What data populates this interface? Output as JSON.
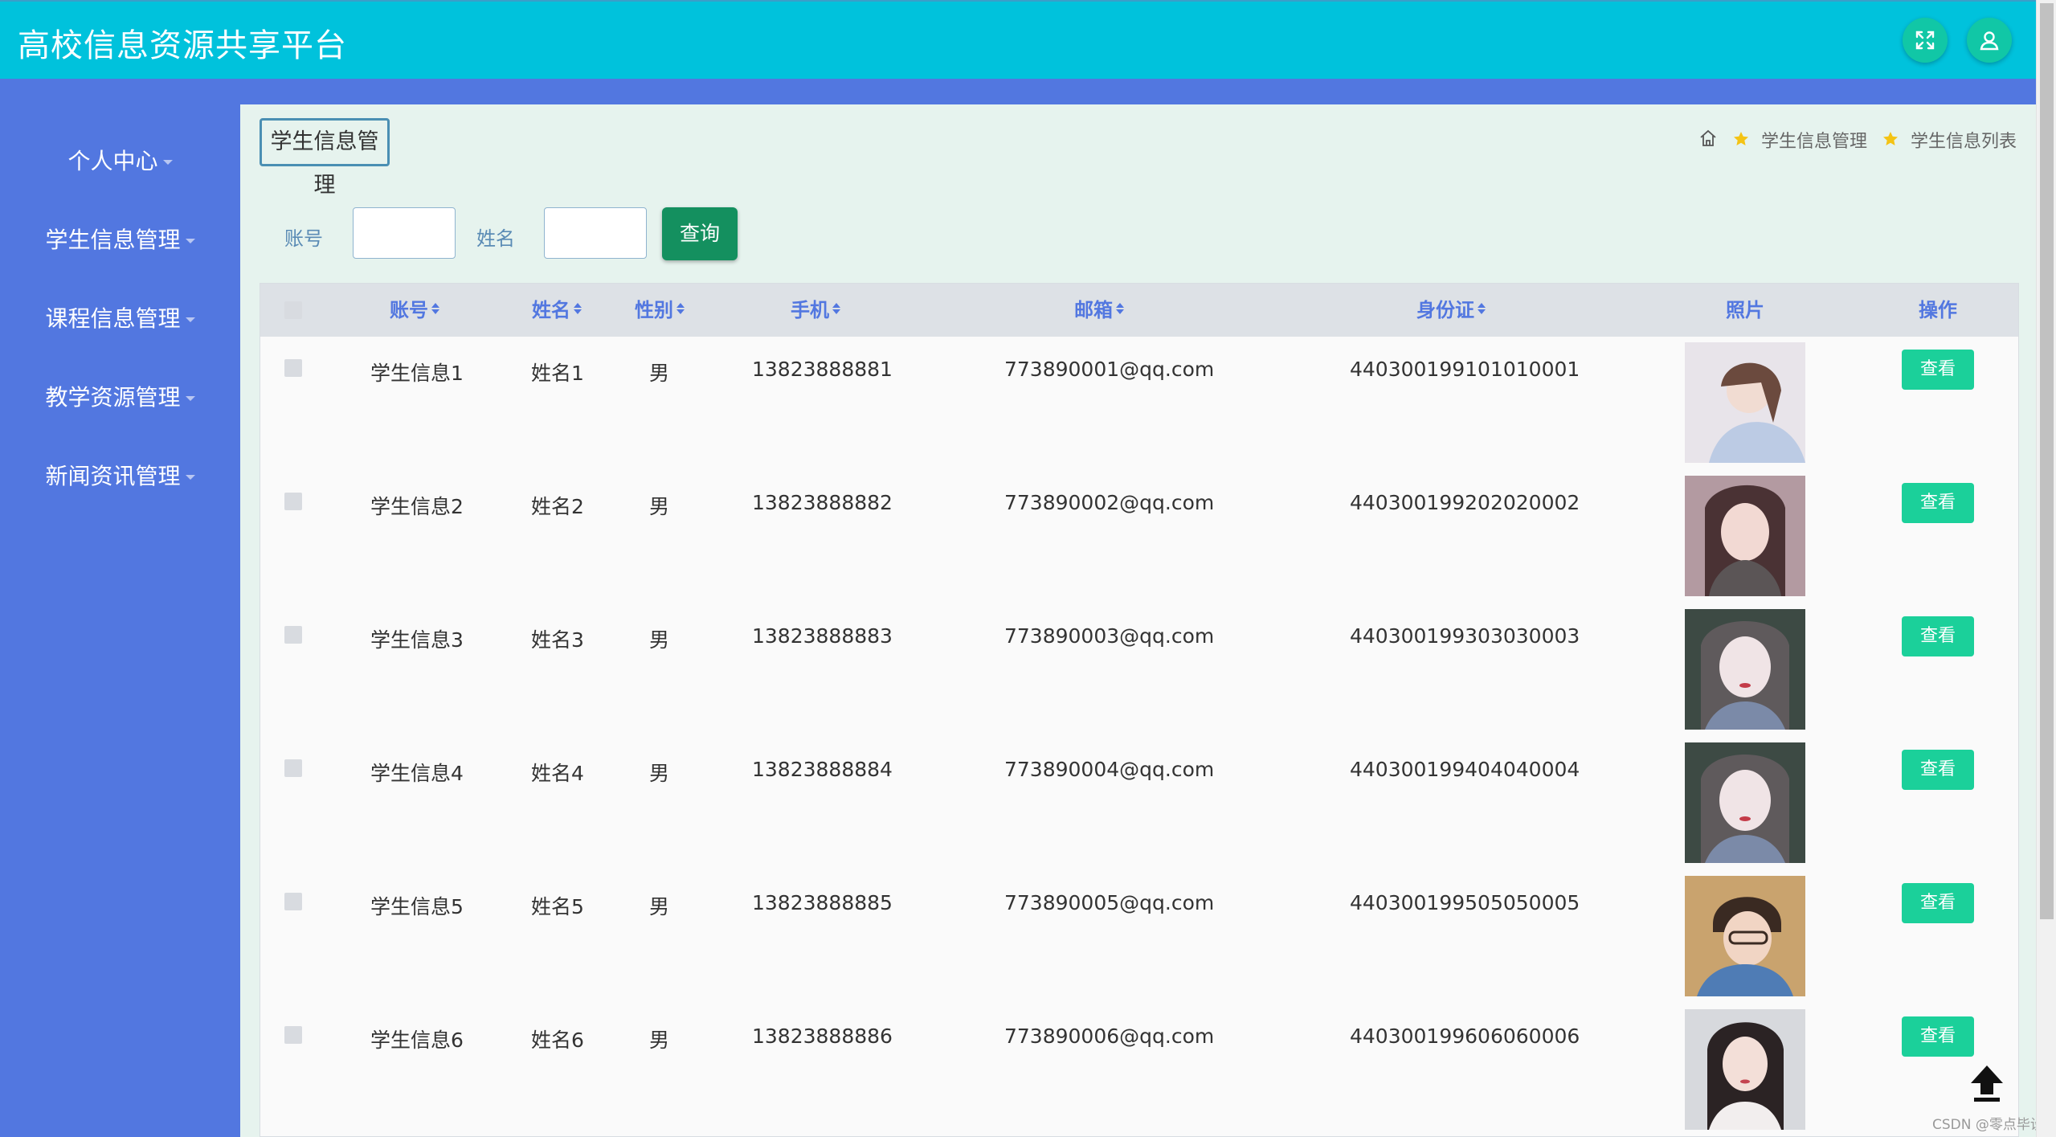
{
  "app": {
    "title": "高校信息资源共享平台"
  },
  "header": {
    "fullscreen_icon": "fullscreen-icon",
    "user_icon": "user-icon"
  },
  "sidebar": {
    "items": [
      {
        "label": "个人中心"
      },
      {
        "label": "学生信息管理"
      },
      {
        "label": "课程信息管理"
      },
      {
        "label": "教学资源管理"
      },
      {
        "label": "新闻资讯管理"
      }
    ]
  },
  "page": {
    "tag": "学生信息管理",
    "breadcrumb": [
      "学生信息管理",
      "学生信息列表"
    ]
  },
  "search": {
    "account_label": "账号",
    "account_value": "",
    "name_label": "姓名",
    "name_value": "",
    "query_label": "查询"
  },
  "table": {
    "headers": [
      "账号",
      "姓名",
      "性别",
      "手机",
      "邮箱",
      "身份证",
      "照片",
      "操作"
    ],
    "rows": [
      {
        "account": "学生信息1",
        "name": "姓名1",
        "gender": "男",
        "phone": "13823888881",
        "email": "773890001@qq.com",
        "id_card": "440300199101010001",
        "action": "查看"
      },
      {
        "account": "学生信息2",
        "name": "姓名2",
        "gender": "男",
        "phone": "13823888882",
        "email": "773890002@qq.com",
        "id_card": "440300199202020002",
        "action": "查看"
      },
      {
        "account": "学生信息3",
        "name": "姓名3",
        "gender": "男",
        "phone": "13823888883",
        "email": "773890003@qq.com",
        "id_card": "440300199303030003",
        "action": "查看"
      },
      {
        "account": "学生信息4",
        "name": "姓名4",
        "gender": "男",
        "phone": "13823888884",
        "email": "773890004@qq.com",
        "id_card": "440300199404040004",
        "action": "查看"
      },
      {
        "account": "学生信息5",
        "name": "姓名5",
        "gender": "男",
        "phone": "13823888885",
        "email": "773890005@qq.com",
        "id_card": "440300199505050005",
        "action": "查看"
      },
      {
        "account": "学生信息6",
        "name": "姓名6",
        "gender": "男",
        "phone": "13823888886",
        "email": "773890006@qq.com",
        "id_card": "440300199606060006",
        "action": "查看"
      }
    ]
  },
  "footer": {
    "watermark": "CSDN @零点毕设"
  },
  "colors": {
    "header": "#00c2dc",
    "sidebar": "#5277e0",
    "accent_button": "#1bd09a",
    "query_button": "#14905f"
  }
}
